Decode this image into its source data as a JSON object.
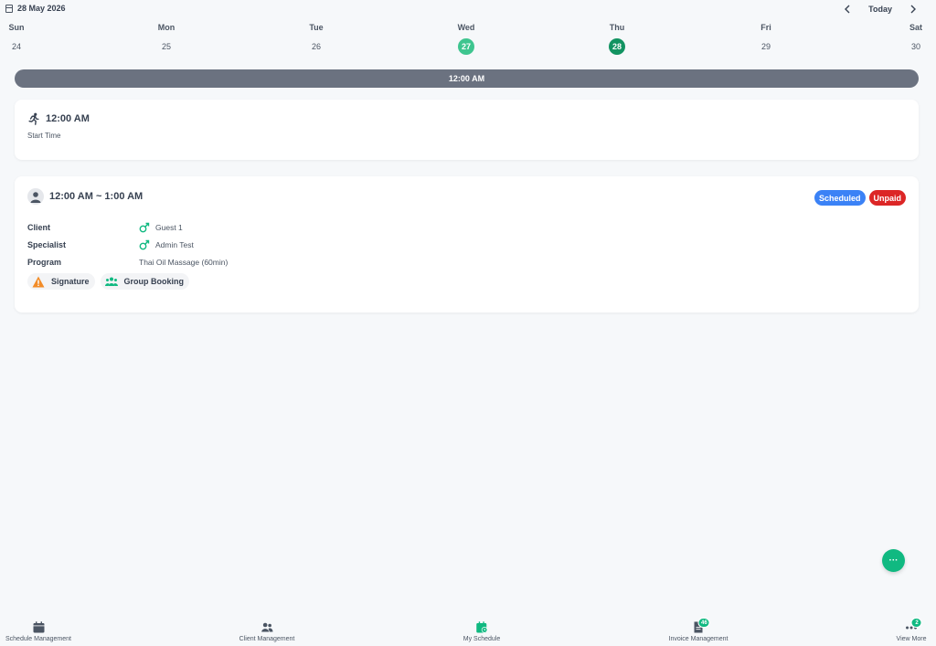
{
  "header": {
    "date": "28 May 2026",
    "today_label": "Today"
  },
  "week": {
    "days": [
      {
        "name": "Sun",
        "num": "24"
      },
      {
        "name": "Mon",
        "num": "25"
      },
      {
        "name": "Tue",
        "num": "26"
      },
      {
        "name": "Wed",
        "num": "27"
      },
      {
        "name": "Thu",
        "num": "28"
      },
      {
        "name": "Fri",
        "num": "29"
      },
      {
        "name": "Sat",
        "num": "30"
      }
    ]
  },
  "time_bar": "12:00 AM",
  "start_card": {
    "time": "12:00 AM",
    "label": "Start Time"
  },
  "appointment": {
    "time_range": "12:00 AM ~ 1:00 AM",
    "status_badge": "Scheduled",
    "payment_badge": "Unpaid",
    "client_label": "Client",
    "client_value": "Guest 1",
    "specialist_label": "Specialist",
    "specialist_value": "Admin Test",
    "program_label": "Program",
    "program_value": "Thai Oil Massage (60min)",
    "tags": [
      "Signature",
      "Group Booking"
    ]
  },
  "fab": "···",
  "bottom_nav": {
    "items": [
      {
        "label": "Schedule Management",
        "icon": "calendar-icon"
      },
      {
        "label": "Client Management",
        "icon": "users-icon"
      },
      {
        "label": "My Schedule",
        "icon": "calendar-clock-icon"
      },
      {
        "label": "Invoice Management",
        "icon": "invoice-icon",
        "badge": "46"
      },
      {
        "label": "View More",
        "icon": "more-icon",
        "badge": "2"
      }
    ]
  },
  "colors": {
    "accent": "#10b981",
    "selected_day_light": "#3ec58f",
    "selected_day_dark": "#129361",
    "scheduled": "#3b82f6",
    "unpaid": "#dc2626",
    "time_bar": "#6b7280"
  }
}
